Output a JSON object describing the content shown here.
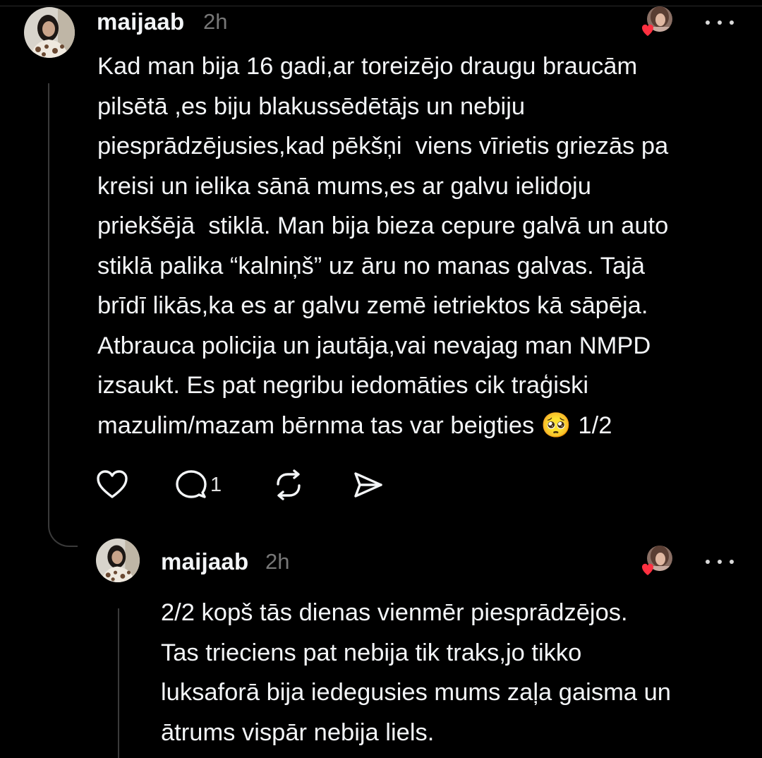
{
  "posts": [
    {
      "username": "maijaab",
      "time": "2h",
      "text": "Kad man bija 16 gadi,ar toreizējo draugu braucām\npilsētā ,es biju blakussēdētājs un nebiju\npiesprādzējusies,kad pēkšņi  viens vīrietis griezās pa\nkreisi un ielika sānā mums,es ar galvu ielidoju\npriekšējā  stiklā. Man bija bieza cepure galvā un auto\nstiklā palika “kalniņš” uz āru no manas galvas. Tajā\nbrīdī likās,ka es ar galvu zemē ietriektos kā sāpēja.\nAtbrauca policija un jautāja,vai nevajag man NMPD\nizsaukt. Es pat negribu iedomāties cik traģiski\nmazulim/mazam bērnma tas var beigties 🥺 1/2",
      "reply_count": "1",
      "icons": {
        "like": "heart-outline-icon",
        "reply": "speech-bubble-icon",
        "repost": "repost-arrows-icon",
        "share": "paper-plane-icon"
      }
    },
    {
      "username": "maijaab",
      "time": "2h",
      "text": "2/2 kopš tās dienas vienmēr piesprādzējos.\nTas trieciens pat nebija tik traks,jo tikko\nluksaforā bija iedegusies mums zaļa gaisma un\nātrums vispār nebija liels."
    }
  ],
  "colors": {
    "background": "#000000",
    "text": "#f3f5f7",
    "muted": "#777777",
    "like_heart": "#ff3040",
    "thread_line": "#3a3a3a"
  }
}
